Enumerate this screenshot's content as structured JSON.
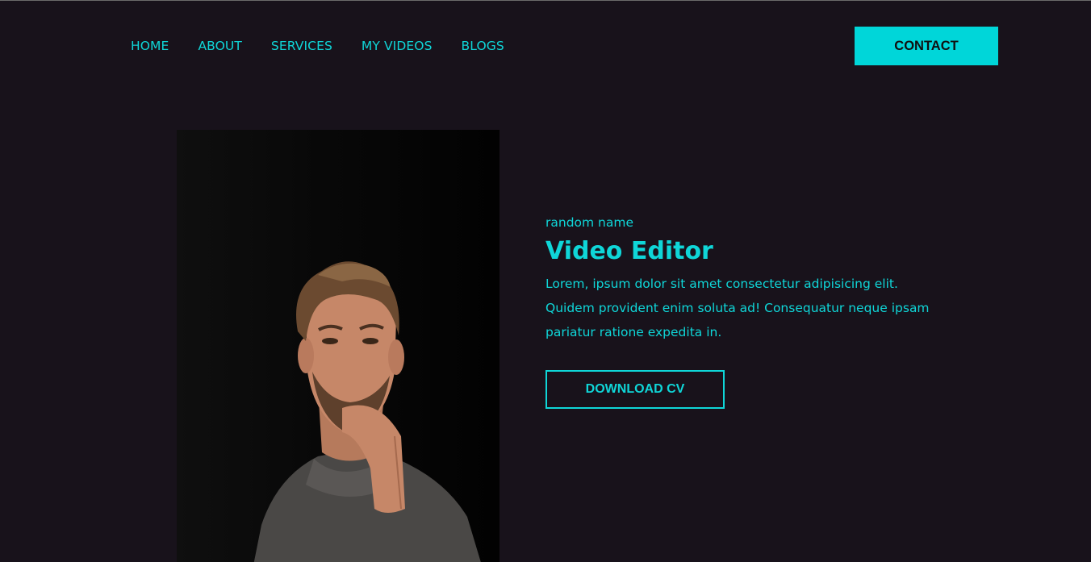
{
  "nav": {
    "items": [
      {
        "label": "HOME"
      },
      {
        "label": "ABOUT"
      },
      {
        "label": "SERVICES"
      },
      {
        "label": "MY VIDEOS"
      },
      {
        "label": "BLOGS"
      }
    ],
    "contact_label": "CONTACT"
  },
  "hero": {
    "name": "random name",
    "role": "Video Editor",
    "description": "Lorem, ipsum dolor sit amet consectetur adipisicing elit. Quidem provident enim soluta ad! Consequatur neque ipsam pariatur ratione expedita in.",
    "download_label": "DOWNLOAD CV"
  },
  "colors": {
    "background": "#18121b",
    "accent": "#00d6d9"
  }
}
